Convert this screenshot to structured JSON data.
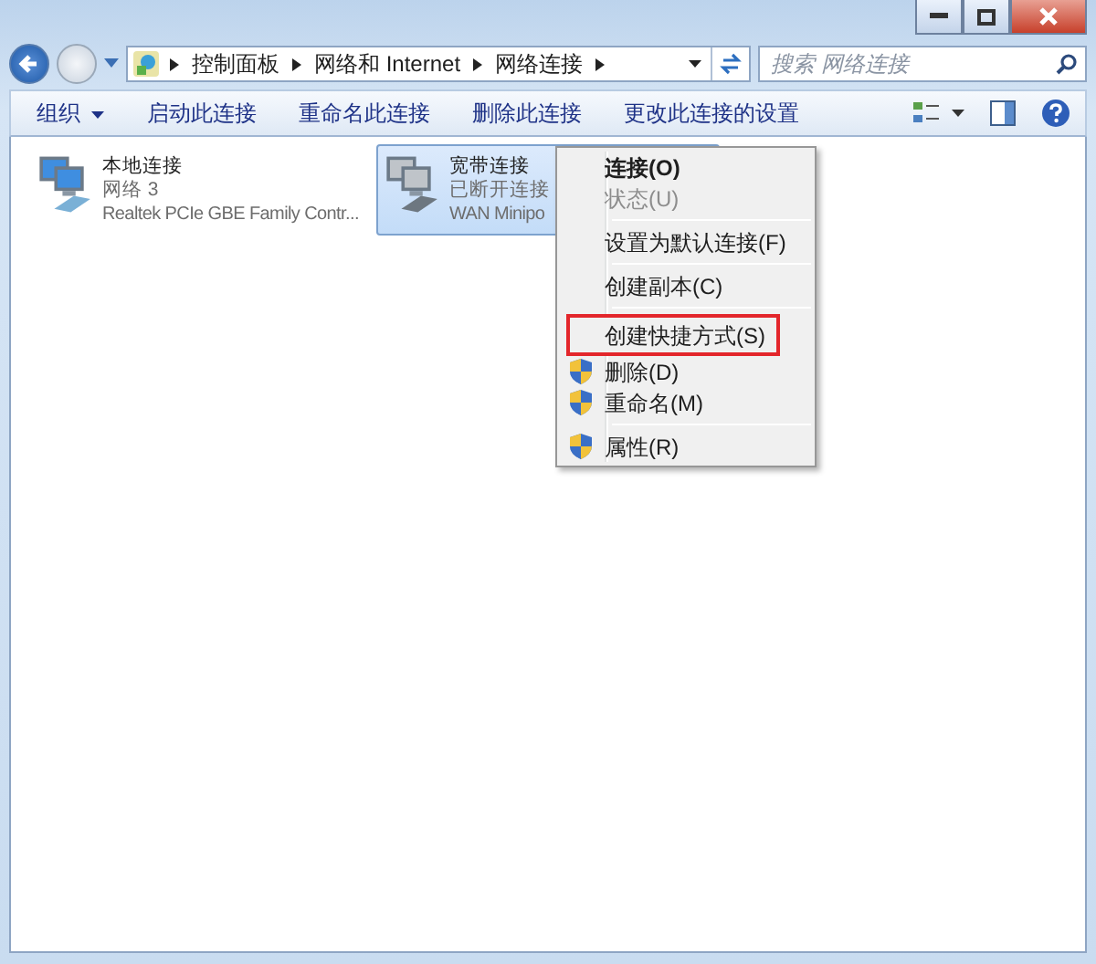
{
  "address_bar": {
    "path": [
      "控制面板",
      "网络和 Internet",
      "网络连接"
    ]
  },
  "search": {
    "placeholder": "搜索 网络连接"
  },
  "toolbar": [
    {
      "label": "组织",
      "dropdown": true
    },
    {
      "label": "启动此连接",
      "dropdown": false
    },
    {
      "label": "重命名此连接",
      "dropdown": false
    },
    {
      "label": "删除此连接",
      "dropdown": false
    },
    {
      "label": "更改此连接的设置",
      "dropdown": false
    }
  ],
  "connections": [
    {
      "name": "本地连接",
      "status": "网络 3",
      "adapter": "Realtek PCIe GBE Family Contr...",
      "selected": false
    },
    {
      "name": "宽带连接",
      "status": "已断开连接",
      "adapter": "WAN Minipo",
      "selected": true
    }
  ],
  "context_menu": [
    {
      "kind": "item",
      "label": "连接(O)",
      "bold": true,
      "disabled": false,
      "shield": false,
      "highlighted": false
    },
    {
      "kind": "item",
      "label": "状态(U)",
      "bold": false,
      "disabled": true,
      "shield": false,
      "highlighted": false
    },
    {
      "kind": "separator"
    },
    {
      "kind": "item",
      "label": "设置为默认连接(F)",
      "bold": false,
      "disabled": false,
      "shield": false,
      "highlighted": false
    },
    {
      "kind": "separator"
    },
    {
      "kind": "item",
      "label": "创建副本(C)",
      "bold": false,
      "disabled": false,
      "shield": false,
      "highlighted": false
    },
    {
      "kind": "separator"
    },
    {
      "kind": "item",
      "label": "创建快捷方式(S)",
      "bold": false,
      "disabled": false,
      "shield": false,
      "highlighted": true
    },
    {
      "kind": "item",
      "label": "删除(D)",
      "bold": false,
      "disabled": false,
      "shield": true,
      "highlighted": false
    },
    {
      "kind": "item",
      "label": "重命名(M)",
      "bold": false,
      "disabled": false,
      "shield": true,
      "highlighted": false
    },
    {
      "kind": "separator"
    },
    {
      "kind": "item",
      "label": "属性(R)",
      "bold": false,
      "disabled": false,
      "shield": true,
      "highlighted": false
    }
  ]
}
